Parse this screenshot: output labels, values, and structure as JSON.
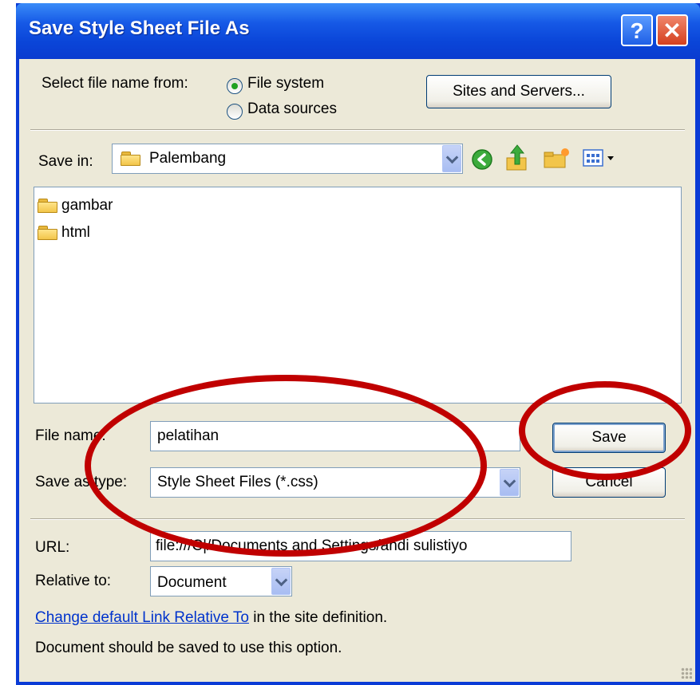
{
  "dialog": {
    "title": "Save Style Sheet File As",
    "help_label": "?",
    "close_label": "✕"
  },
  "select_from": {
    "label": "Select file name from:",
    "options": [
      "File system",
      "Data sources"
    ],
    "selected": "File system",
    "sites_button": "Sites and Servers..."
  },
  "save_in": {
    "label": "Save in:",
    "value": "Palembang",
    "toolbar_icons": [
      "back-icon",
      "up-folder-icon",
      "new-folder-icon",
      "view-menu-icon"
    ]
  },
  "files": [
    {
      "name": "gambar",
      "icon": "folder-icon"
    },
    {
      "name": "html",
      "icon": "folder-icon"
    }
  ],
  "file_name": {
    "label": "File name:",
    "value": "pelatihan"
  },
  "save_as_type": {
    "label": "Save as type:",
    "value": "Style Sheet Files (*.css)"
  },
  "buttons": {
    "save": "Save",
    "cancel": "Cancel"
  },
  "url": {
    "label": "URL:",
    "value": "file:///C|/Documents and Settings/andi sulistiyo"
  },
  "relative_to": {
    "label": "Relative to:",
    "value": "Document"
  },
  "link_line": {
    "link_text": "Change default Link Relative To",
    "rest_text": " in the site definition."
  },
  "note": "Document should be saved to use this option.",
  "colors": {
    "titlebar": "#0a45d8",
    "face": "#ece9d8",
    "annotation": "#c00000",
    "link": "#0033cc"
  }
}
